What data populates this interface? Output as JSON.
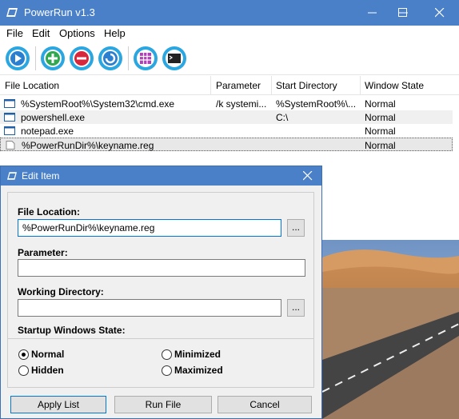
{
  "window": {
    "title": "PowerRun v1.3"
  },
  "menu": [
    "File",
    "Edit",
    "Options",
    "Help"
  ],
  "toolbar": [
    {
      "icon": "play-icon"
    },
    {
      "icon": "add-icon"
    },
    {
      "icon": "remove-icon"
    },
    {
      "icon": "refresh-icon"
    },
    {
      "icon": "grid-icon"
    },
    {
      "icon": "cmd-icon"
    }
  ],
  "list": {
    "columns": [
      "File Location",
      "Parameter",
      "Start Directory",
      "Window State"
    ],
    "rows": [
      [
        "%SystemRoot%\\System32\\cmd.exe",
        "/k systemi...",
        "%SystemRoot%\\...",
        "Normal"
      ],
      [
        "powershell.exe",
        "",
        "C:\\",
        "Normal"
      ],
      [
        "notepad.exe",
        "",
        "",
        "Normal"
      ],
      [
        "%PowerRunDir%\\keyname.reg",
        "",
        "",
        "Normal"
      ]
    ]
  },
  "dialog": {
    "title": "Edit Item",
    "file_location_label": "File Location:",
    "file_location_value": "%PowerRunDir%\\keyname.reg",
    "parameter_label": "Parameter:",
    "parameter_value": "",
    "working_dir_label": "Working Directory:",
    "working_dir_value": "",
    "browse_label": "...",
    "state_label": "Startup Windows State:",
    "states": [
      "Normal",
      "Minimized",
      "Hidden",
      "Maximized"
    ],
    "selected_state": "Normal",
    "buttons": {
      "apply": "Apply List",
      "run": "Run File",
      "cancel": "Cancel"
    }
  },
  "colors": {
    "titlebar": "#4a80c8",
    "accent": "#0078d7"
  }
}
